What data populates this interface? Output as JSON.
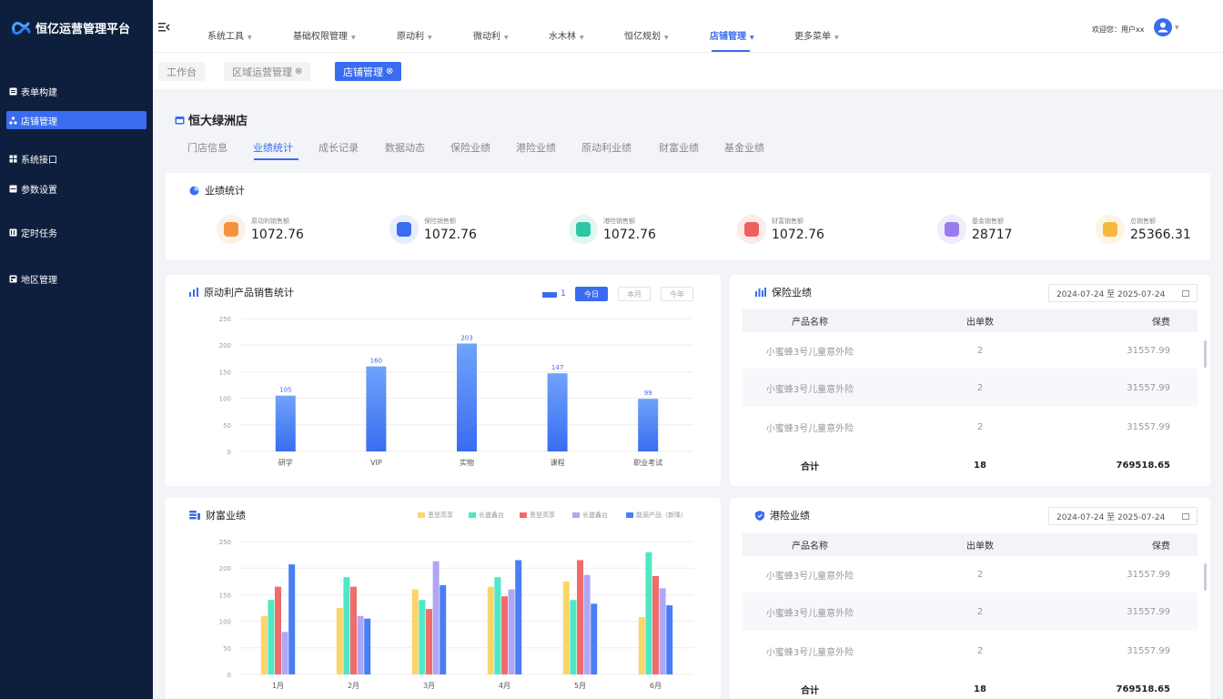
{
  "app": {
    "title": "恒亿运营管理平台"
  },
  "colors": {
    "sidebar_bg": "#0e1f3d",
    "accent": "#3a6cf0"
  },
  "sidebar": {
    "items": [
      {
        "label": "表单构建",
        "icon": "form-icon"
      },
      {
        "label": "店铺管理",
        "icon": "shop-icon",
        "active": true
      },
      {
        "label": "系统接口",
        "icon": "api-icon"
      },
      {
        "label": "参数设置",
        "icon": "settings-icon"
      },
      {
        "label": "定时任务",
        "icon": "clock-icon"
      },
      {
        "label": "地区管理",
        "icon": "region-icon"
      }
    ]
  },
  "topnav": {
    "menus": [
      "系统工具",
      "基础权限管理",
      "原动利",
      "微动利",
      "水木林",
      "恒亿规划",
      "店铺管理",
      "更多菜单"
    ],
    "active_menu": "店铺管理",
    "welcome": "欢迎您：用户xx"
  },
  "tabs": [
    {
      "label": "工作台"
    },
    {
      "label": "区域运营管理",
      "close": "⊗"
    },
    {
      "label": "店铺管理",
      "close": "⊗",
      "active": true
    }
  ],
  "store": {
    "name": "恒大绿洲店"
  },
  "subtabs": [
    "门店信息",
    "业绩统计",
    "成长记录",
    "数据动态",
    "保险业绩",
    "港险业绩",
    "原动利业绩",
    "财富业绩",
    "基金业绩"
  ],
  "active_subtab": "业绩统计",
  "perf": {
    "title": "业绩统计",
    "kpis": [
      {
        "label": "原动利销售额",
        "value": "1072.76",
        "color": "#f5923e",
        "bg": "#fdf0e5"
      },
      {
        "label": "保险销售额",
        "value": "1072.76",
        "color": "#3a6cf0",
        "bg": "#e7eefd"
      },
      {
        "label": "港险销售额",
        "value": "1072.76",
        "color": "#2ec7a4",
        "bg": "#e3f7f2"
      },
      {
        "label": "财富销售额",
        "value": "1072.76",
        "color": "#f05f5f",
        "bg": "#fdeaea"
      },
      {
        "label": "基金销售额",
        "value": "28717",
        "color": "#9b7bf0",
        "bg": "#f0ebfd"
      },
      {
        "label": "总销售额",
        "value": "25366.31",
        "color": "#f5b83d",
        "bg": "#fdf4e2"
      }
    ]
  },
  "product_chart": {
    "title": "原动利产品销售统计",
    "legend_label": "1",
    "periods": [
      "今日",
      "本月",
      "今年"
    ],
    "active_period": "今日"
  },
  "wealth_chart": {
    "title": "财富业绩"
  },
  "chart_data": [
    {
      "type": "bar",
      "title": "原动利产品销售统计",
      "categories": [
        "研学",
        "VIP",
        "实物",
        "课程",
        "职业考试"
      ],
      "series": [
        {
          "name": "1",
          "values": [
            105,
            160,
            203,
            147,
            99
          ]
        }
      ],
      "y_ticks": [
        0,
        50,
        100,
        150,
        200,
        250
      ],
      "ylim": [
        0,
        250
      ],
      "value_shown": [
        105,
        160,
        203,
        147,
        99
      ],
      "grid": true,
      "legend": "top-right"
    },
    {
      "type": "bar",
      "title": "财富业绩",
      "categories": [
        "1月",
        "2月",
        "3月",
        "4月",
        "5月",
        "6月"
      ],
      "series": [
        {
          "name": "恩登高享",
          "color": "#fcd56a",
          "values": [
            110,
            125,
            160,
            165,
            175,
            108
          ]
        },
        {
          "name": "长盛鑫台",
          "color": "#4ee8c4",
          "values": [
            140,
            183,
            140,
            183,
            140,
            230
          ]
        },
        {
          "name": "恩登高享",
          "color": "#f26b6b",
          "values": [
            165,
            165,
            123,
            147,
            215,
            185
          ]
        },
        {
          "name": "长盛鑫台",
          "color": "#b0a6f5",
          "values": [
            80,
            110,
            213,
            160,
            187,
            162
          ]
        },
        {
          "name": "能源产品（新降）",
          "color": "#4a7ef5",
          "values": [
            207,
            105,
            168,
            215,
            133,
            130
          ]
        }
      ],
      "y_ticks": [
        0,
        50,
        100,
        150,
        200,
        250
      ],
      "ylim": [
        0,
        250
      ],
      "grid": true,
      "legend": "top-right"
    }
  ],
  "insurance": {
    "title": "保险业绩",
    "date_range": "2024-07-24  至  2025-07-24",
    "columns": [
      "产品名称",
      "出单数",
      "保费"
    ],
    "rows": [
      [
        "小蜜蜂3号儿童意外险",
        "2",
        "31557.99"
      ],
      [
        "小蜜蜂3号儿童意外险",
        "2",
        "31557.99"
      ],
      [
        "小蜜蜂3号儿童意外险",
        "2",
        "31557.99"
      ]
    ],
    "total": [
      "合计",
      "18",
      "769518.65"
    ]
  },
  "hk_insurance": {
    "title": "港险业绩",
    "date_range": "2024-07-24  至  2025-07-24",
    "columns": [
      "产品名称",
      "出单数",
      "保费"
    ],
    "rows": [
      [
        "小蜜蜂3号儿童意外险",
        "2",
        "31557.99"
      ],
      [
        "小蜜蜂3号儿童意外险",
        "2",
        "31557.99"
      ],
      [
        "小蜜蜂3号儿童意外险",
        "2",
        "31557.99"
      ]
    ],
    "total": [
      "合计",
      "18",
      "769518.65"
    ]
  }
}
